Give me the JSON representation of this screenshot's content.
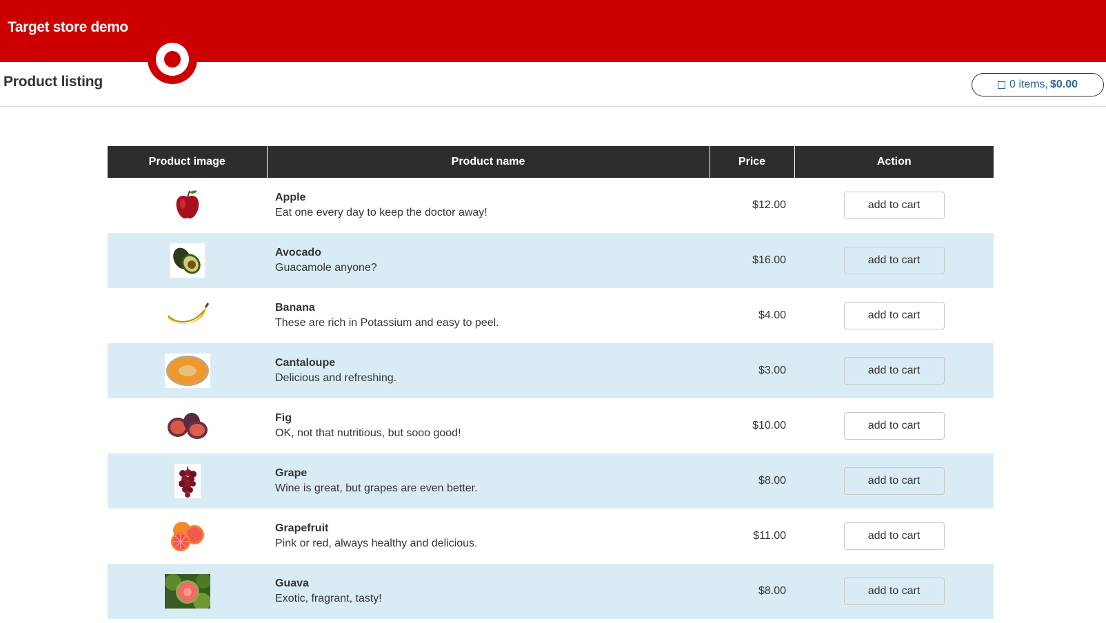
{
  "header": {
    "brand": "Target store demo"
  },
  "subheader": {
    "title": "Product listing"
  },
  "cart": {
    "items_label": "0 items,",
    "total": "$0.00"
  },
  "table": {
    "columns": [
      "Product image",
      "Product name",
      "Price",
      "Action"
    ],
    "rows": [
      {
        "name": "Apple",
        "description": "Eat one every day to keep the doctor away!",
        "price": "$12.00",
        "action": "add to cart",
        "icon": "apple-icon"
      },
      {
        "name": "Avocado",
        "description": "Guacamole anyone?",
        "price": "$16.00",
        "action": "add to cart",
        "icon": "avocado-icon"
      },
      {
        "name": "Banana",
        "description": "These are rich in Potassium and easy to peel.",
        "price": "$4.00",
        "action": "add to cart",
        "icon": "banana-icon"
      },
      {
        "name": "Cantaloupe",
        "description": "Delicious and refreshing.",
        "price": "$3.00",
        "action": "add to cart",
        "icon": "cantaloupe-icon"
      },
      {
        "name": "Fig",
        "description": "OK, not that nutritious, but sooo good!",
        "price": "$10.00",
        "action": "add to cart",
        "icon": "fig-icon"
      },
      {
        "name": "Grape",
        "description": "Wine is great, but grapes are even better.",
        "price": "$8.00",
        "action": "add to cart",
        "icon": "grape-icon"
      },
      {
        "name": "Grapefruit",
        "description": "Pink or red, always healthy and delicious.",
        "price": "$11.00",
        "action": "add to cart",
        "icon": "grapefruit-icon"
      },
      {
        "name": "Guava",
        "description": "Exotic, fragrant, tasty!",
        "price": "$8.00",
        "action": "add to cart",
        "icon": "guava-icon"
      }
    ]
  },
  "colors": {
    "brand_red": "#cc0000",
    "header_dark": "#2c2d30",
    "row_alt": "#d9ecf6",
    "link_blue": "#2a6496"
  }
}
